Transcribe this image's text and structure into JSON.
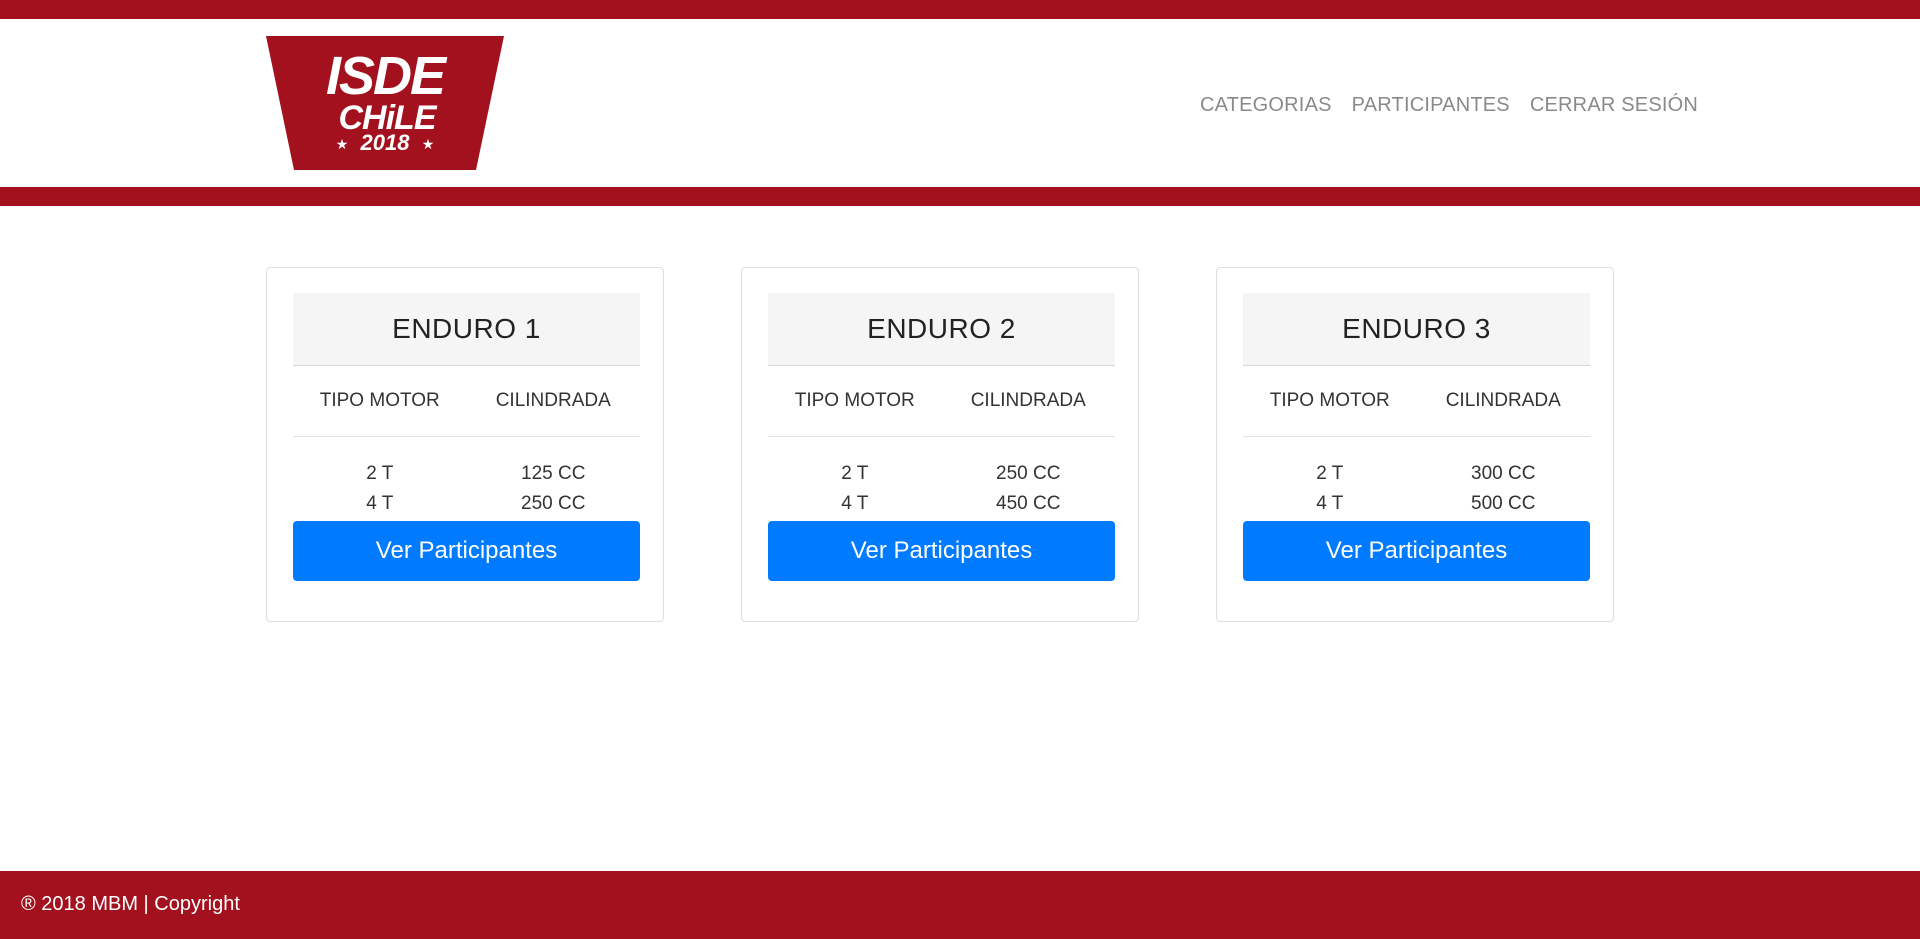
{
  "brand": {
    "logo_line1": "ISDE",
    "logo_line2": "CHiLE",
    "logo_line3": "2018",
    "color": "#a3111e"
  },
  "nav": {
    "items": [
      {
        "label": "CATEGORIAS"
      },
      {
        "label": "PARTICIPANTES"
      },
      {
        "label": "CERRAR SESIÓN"
      }
    ]
  },
  "categories": [
    {
      "title": "ENDURO 1",
      "col1_header": "TIPO MOTOR",
      "col2_header": "CILINDRADA",
      "rows": [
        {
          "motor": "2 T",
          "cc": "125 CC"
        },
        {
          "motor": "4 T",
          "cc": "250 CC"
        }
      ],
      "button_label": "Ver Participantes"
    },
    {
      "title": "ENDURO 2",
      "col1_header": "TIPO MOTOR",
      "col2_header": "CILINDRADA",
      "rows": [
        {
          "motor": "2 T",
          "cc": "250 CC"
        },
        {
          "motor": "4 T",
          "cc": "450 CC"
        }
      ],
      "button_label": "Ver Participantes"
    },
    {
      "title": "ENDURO 3",
      "col1_header": "TIPO MOTOR",
      "col2_header": "CILINDRADA",
      "rows": [
        {
          "motor": "2 T",
          "cc": "300 CC"
        },
        {
          "motor": "4 T",
          "cc": "500 CC"
        }
      ],
      "button_label": "Ver Participantes"
    }
  ],
  "footer": {
    "text": "® 2018 MBM | Copyright"
  },
  "colors": {
    "primary_button": "#007bff",
    "brand_red": "#a3111e"
  }
}
